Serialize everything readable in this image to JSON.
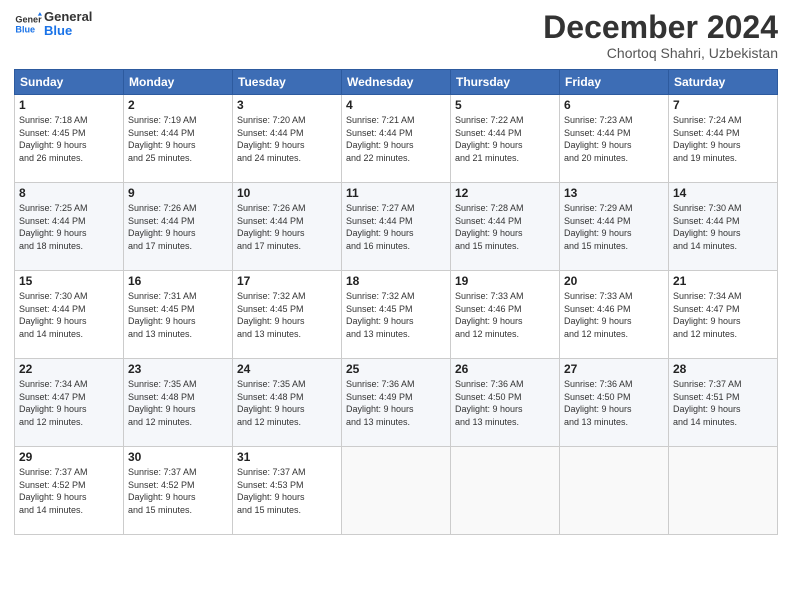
{
  "header": {
    "logo_line1": "General",
    "logo_line2": "Blue",
    "month": "December 2024",
    "location": "Chortoq Shahri, Uzbekistan"
  },
  "weekdays": [
    "Sunday",
    "Monday",
    "Tuesday",
    "Wednesday",
    "Thursday",
    "Friday",
    "Saturday"
  ],
  "weeks": [
    [
      {
        "day": "1",
        "info": "Sunrise: 7:18 AM\nSunset: 4:45 PM\nDaylight: 9 hours\nand 26 minutes."
      },
      {
        "day": "2",
        "info": "Sunrise: 7:19 AM\nSunset: 4:44 PM\nDaylight: 9 hours\nand 25 minutes."
      },
      {
        "day": "3",
        "info": "Sunrise: 7:20 AM\nSunset: 4:44 PM\nDaylight: 9 hours\nand 24 minutes."
      },
      {
        "day": "4",
        "info": "Sunrise: 7:21 AM\nSunset: 4:44 PM\nDaylight: 9 hours\nand 22 minutes."
      },
      {
        "day": "5",
        "info": "Sunrise: 7:22 AM\nSunset: 4:44 PM\nDaylight: 9 hours\nand 21 minutes."
      },
      {
        "day": "6",
        "info": "Sunrise: 7:23 AM\nSunset: 4:44 PM\nDaylight: 9 hours\nand 20 minutes."
      },
      {
        "day": "7",
        "info": "Sunrise: 7:24 AM\nSunset: 4:44 PM\nDaylight: 9 hours\nand 19 minutes."
      }
    ],
    [
      {
        "day": "8",
        "info": "Sunrise: 7:25 AM\nSunset: 4:44 PM\nDaylight: 9 hours\nand 18 minutes."
      },
      {
        "day": "9",
        "info": "Sunrise: 7:26 AM\nSunset: 4:44 PM\nDaylight: 9 hours\nand 17 minutes."
      },
      {
        "day": "10",
        "info": "Sunrise: 7:26 AM\nSunset: 4:44 PM\nDaylight: 9 hours\nand 17 minutes."
      },
      {
        "day": "11",
        "info": "Sunrise: 7:27 AM\nSunset: 4:44 PM\nDaylight: 9 hours\nand 16 minutes."
      },
      {
        "day": "12",
        "info": "Sunrise: 7:28 AM\nSunset: 4:44 PM\nDaylight: 9 hours\nand 15 minutes."
      },
      {
        "day": "13",
        "info": "Sunrise: 7:29 AM\nSunset: 4:44 PM\nDaylight: 9 hours\nand 15 minutes."
      },
      {
        "day": "14",
        "info": "Sunrise: 7:30 AM\nSunset: 4:44 PM\nDaylight: 9 hours\nand 14 minutes."
      }
    ],
    [
      {
        "day": "15",
        "info": "Sunrise: 7:30 AM\nSunset: 4:44 PM\nDaylight: 9 hours\nand 14 minutes."
      },
      {
        "day": "16",
        "info": "Sunrise: 7:31 AM\nSunset: 4:45 PM\nDaylight: 9 hours\nand 13 minutes."
      },
      {
        "day": "17",
        "info": "Sunrise: 7:32 AM\nSunset: 4:45 PM\nDaylight: 9 hours\nand 13 minutes."
      },
      {
        "day": "18",
        "info": "Sunrise: 7:32 AM\nSunset: 4:45 PM\nDaylight: 9 hours\nand 13 minutes."
      },
      {
        "day": "19",
        "info": "Sunrise: 7:33 AM\nSunset: 4:46 PM\nDaylight: 9 hours\nand 12 minutes."
      },
      {
        "day": "20",
        "info": "Sunrise: 7:33 AM\nSunset: 4:46 PM\nDaylight: 9 hours\nand 12 minutes."
      },
      {
        "day": "21",
        "info": "Sunrise: 7:34 AM\nSunset: 4:47 PM\nDaylight: 9 hours\nand 12 minutes."
      }
    ],
    [
      {
        "day": "22",
        "info": "Sunrise: 7:34 AM\nSunset: 4:47 PM\nDaylight: 9 hours\nand 12 minutes."
      },
      {
        "day": "23",
        "info": "Sunrise: 7:35 AM\nSunset: 4:48 PM\nDaylight: 9 hours\nand 12 minutes."
      },
      {
        "day": "24",
        "info": "Sunrise: 7:35 AM\nSunset: 4:48 PM\nDaylight: 9 hours\nand 12 minutes."
      },
      {
        "day": "25",
        "info": "Sunrise: 7:36 AM\nSunset: 4:49 PM\nDaylight: 9 hours\nand 13 minutes."
      },
      {
        "day": "26",
        "info": "Sunrise: 7:36 AM\nSunset: 4:50 PM\nDaylight: 9 hours\nand 13 minutes."
      },
      {
        "day": "27",
        "info": "Sunrise: 7:36 AM\nSunset: 4:50 PM\nDaylight: 9 hours\nand 13 minutes."
      },
      {
        "day": "28",
        "info": "Sunrise: 7:37 AM\nSunset: 4:51 PM\nDaylight: 9 hours\nand 14 minutes."
      }
    ],
    [
      {
        "day": "29",
        "info": "Sunrise: 7:37 AM\nSunset: 4:52 PM\nDaylight: 9 hours\nand 14 minutes."
      },
      {
        "day": "30",
        "info": "Sunrise: 7:37 AM\nSunset: 4:52 PM\nDaylight: 9 hours\nand 15 minutes."
      },
      {
        "day": "31",
        "info": "Sunrise: 7:37 AM\nSunset: 4:53 PM\nDaylight: 9 hours\nand 15 minutes."
      },
      null,
      null,
      null,
      null
    ]
  ]
}
